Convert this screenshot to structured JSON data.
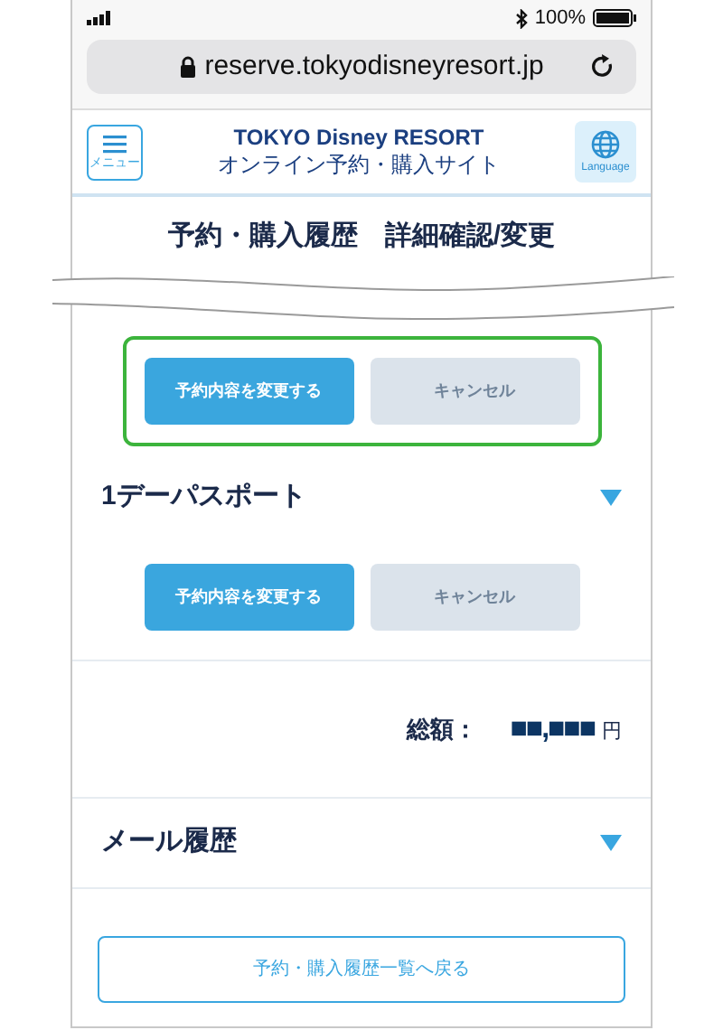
{
  "status_bar": {
    "battery_text": "100%"
  },
  "address_bar": {
    "url": "reserve.tokyodisneyresort.jp"
  },
  "header": {
    "menu_label": "メニュー",
    "logo_line1": "TOKYO Disney RESORT",
    "logo_line2": "オンライン予約・購入サイト",
    "language_label": "Language"
  },
  "page_title": "予約・購入履歴　詳細確認/変更",
  "sections": [
    {
      "kind": "actions",
      "highlighted": true,
      "buttons": [
        {
          "label": "予約内容を変更する",
          "disabled": false
        },
        {
          "label": "キャンセル",
          "disabled": true
        }
      ]
    },
    {
      "kind": "accordion",
      "title": "1デーパスポート",
      "expanded": false
    },
    {
      "kind": "actions",
      "highlighted": false,
      "buttons": [
        {
          "label": "予約内容を変更する",
          "disabled": false
        },
        {
          "label": "キャンセル",
          "disabled": true
        }
      ]
    },
    {
      "kind": "total",
      "label": "総額：",
      "amount": "■■,■■■",
      "currency": "円"
    },
    {
      "kind": "accordion",
      "title": "メール履歴",
      "expanded": false
    },
    {
      "kind": "back",
      "label": "予約・購入履歴一覧へ戻る"
    }
  ]
}
